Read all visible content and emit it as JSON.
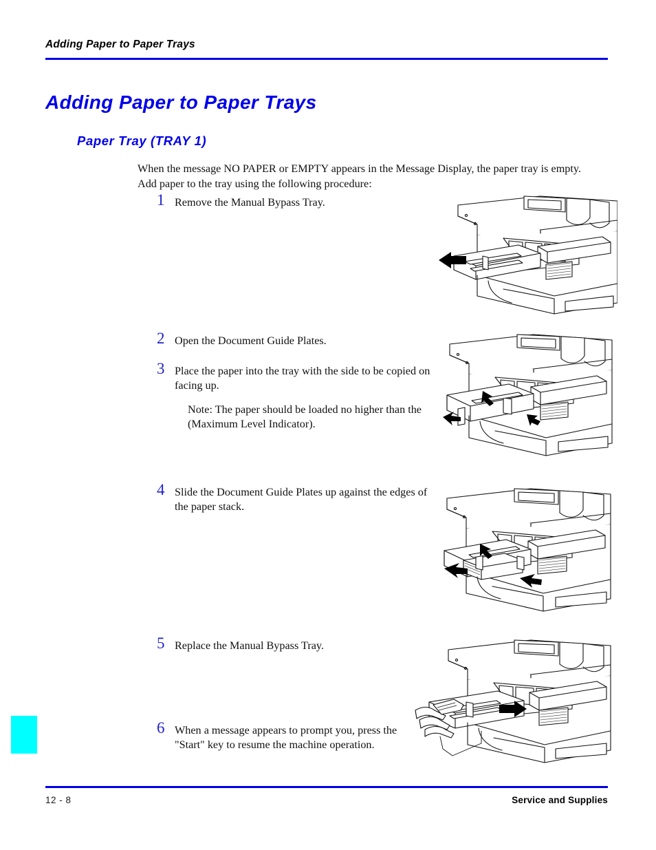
{
  "page": {
    "running_header": "Adding Paper to Paper Trays",
    "chapter_title": "Adding Paper to Paper Trays",
    "section_heading": "Paper Tray (TRAY 1)",
    "intro_paragraph": "When the message NO PAPER or EMPTY appears in the Message Display, the paper tray is empty. Add paper to the tray using the following procedure:",
    "accent_color": "#0000e8",
    "tab_color": "#00ffff",
    "body_text_color": "#111111"
  },
  "steps": [
    {
      "number": "1",
      "text": "Remove the Manual Bypass Tray."
    },
    {
      "number": "2",
      "text": "Open the Document Guide Plates."
    },
    {
      "number": "3",
      "text": "Place the paper into the tray with the side to be copied on facing up.",
      "note": "Note:  The paper should be loaded no higher than the (Maximum Level Indicator)."
    },
    {
      "number": "4",
      "text": "Slide the Document Guide Plates up against the edges of the paper stack."
    },
    {
      "number": "5",
      "text": "Replace the Manual Bypass Tray."
    },
    {
      "number": "6",
      "text": "When a message appears to prompt you, press the \"Start\" key to resume the machine operation."
    }
  ],
  "figures": [
    {
      "caption_id": "figure-remove-bypass-tray",
      "arrow_direction": "left"
    },
    {
      "caption_id": "figure-open-guide-plates",
      "arrow_direction": "outward"
    },
    {
      "caption_id": "figure-slide-guide-plates",
      "arrow_direction": "inward"
    },
    {
      "caption_id": "figure-replace-bypass-tray",
      "arrow_direction": "right"
    }
  ],
  "footer": {
    "page_number": "12 - 8",
    "section_label": "Service and Supplies"
  }
}
